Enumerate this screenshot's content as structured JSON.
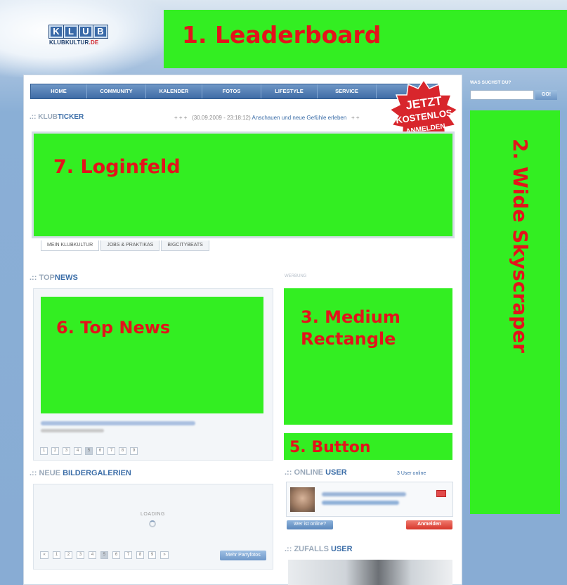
{
  "header": {
    "logo_text": "KLUB",
    "logo_letters": [
      "K",
      "L",
      "U",
      "B"
    ],
    "logo_site_main": "KLUBKULTUR",
    "logo_site_tld": ".DE",
    "leaderboard_label": "1. Leaderboard"
  },
  "nav": {
    "items": [
      "HOME",
      "COMMUNITY",
      "KALENDER",
      "FOTOS",
      "LIFESTYLE",
      "SERVICE"
    ]
  },
  "ticker": {
    "prefix": ".::",
    "label_a": "KLUB",
    "label_b": "TICKER",
    "plus_left": "+ + +",
    "date": "(30.09.2009 - 23:18:12)",
    "headline": "Anschauen und neue Gefühle erleben",
    "plus_right": "+ +"
  },
  "badge": {
    "line1": "JETZT",
    "line2": "KOSTENLOS",
    "line3": "ANMELDEN"
  },
  "login": {
    "label": "7. Loginfeld"
  },
  "tabs": [
    "MEIN KLUBKULTUR",
    "JOBS & PRAKTIKAS",
    "BIGCITYBEATS"
  ],
  "topnews": {
    "prefix": ".::",
    "title_a": "TOP",
    "title_b": "NEWS",
    "label": "6. Top News",
    "pages": [
      "1",
      "2",
      "3",
      "4",
      "5",
      "6",
      "7",
      "8",
      "9"
    ],
    "active_page": "5"
  },
  "ads": {
    "werbung_label": "WERBUNG",
    "medium_rect_line1": "3. Medium",
    "medium_rect_line2": "Rectangle",
    "button_label": "5. Button"
  },
  "online_user": {
    "prefix": ".::",
    "title_a": "ONLINE",
    "title_b": "USER",
    "count": "3 User online",
    "who_button": "Wer ist online?",
    "login_button": "Anmelden"
  },
  "zufalls_user": {
    "prefix": ".::",
    "title_a": "ZUFALLS",
    "title_b": "USER"
  },
  "gallery": {
    "prefix": ".::",
    "title_a": "NEUE",
    "title_b": "BILDERGALERIEN",
    "loading": "LOADING",
    "pages": [
      "«",
      "1",
      "2",
      "3",
      "4",
      "5",
      "6",
      "7",
      "8",
      "9",
      "»"
    ],
    "active_page": "5",
    "more_button": "Mehr Partyfotos"
  },
  "search": {
    "label": "WAS SUCHST DU?",
    "value": "",
    "go": "GO!"
  },
  "skyscraper": {
    "label": "2. Wide Skyscraper"
  }
}
